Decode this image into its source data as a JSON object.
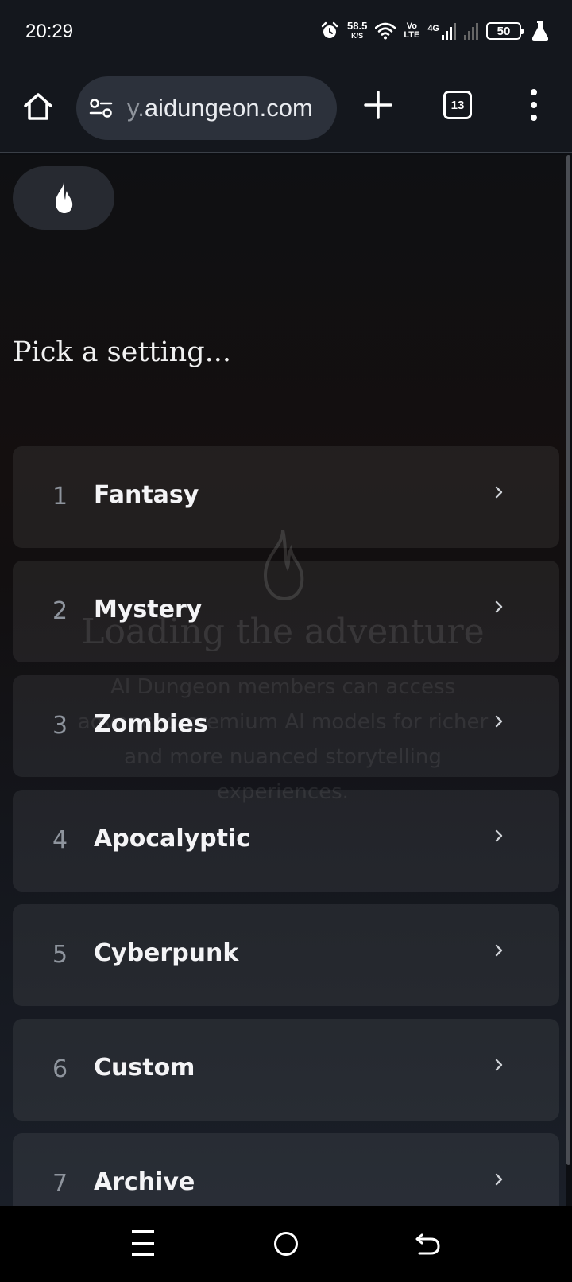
{
  "status_bar": {
    "time": "20:29",
    "speed_value": "58.5",
    "speed_unit": "K/S",
    "volte_top": "Vo",
    "volte_bottom": "LTE",
    "network": "4G",
    "battery": "50",
    "icons": [
      "alarm-icon",
      "wifi-icon",
      "signal-icon",
      "battery-icon",
      "flask-icon"
    ]
  },
  "browser": {
    "url_faded": "y.",
    "url_main": "aidungeon.com",
    "tab_count": "13",
    "icons": [
      "home-icon",
      "site-settings-icon",
      "new-tab-icon",
      "tab-switcher-icon",
      "more-menu-icon"
    ]
  },
  "page": {
    "prompt": "Pick a setting...",
    "settings": [
      {
        "number": "1",
        "label": "Fantasy"
      },
      {
        "number": "2",
        "label": "Mystery"
      },
      {
        "number": "3",
        "label": "Zombies"
      },
      {
        "number": "4",
        "label": "Apocalyptic"
      },
      {
        "number": "5",
        "label": "Cyberpunk"
      },
      {
        "number": "6",
        "label": "Custom"
      },
      {
        "number": "7",
        "label": "Archive"
      }
    ],
    "loading_title": "Loading the adventure",
    "loading_text": "AI Dungeon members can access advanced premium AI models for richer and more nuanced storytelling experiences."
  },
  "nav_bar": {
    "icons": [
      "recents-icon",
      "home-circle-icon",
      "back-icon"
    ]
  }
}
